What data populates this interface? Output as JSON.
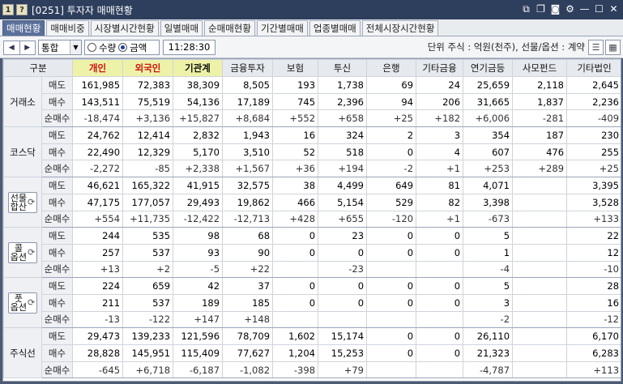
{
  "window": {
    "badge": "1",
    "title": "[0251] 투자자 매매현황",
    "icons": [
      "screen-link-icon",
      "copy-icon",
      "camera-icon",
      "settings-icon",
      "minimize-icon",
      "maximize-icon",
      "close-icon"
    ]
  },
  "tabs": [
    "매매현황",
    "매매비중",
    "시장별시간현황",
    "일별매매",
    "순매매현황",
    "기간별매매",
    "업종별매매",
    "전체시장시간현황"
  ],
  "toolbar": {
    "select_value": "통합",
    "radio_quantity": "수량",
    "radio_amount": "금액",
    "selected_radio": "금액",
    "time": "11:28:30",
    "unit_text": "단위 주식 : 억원(천주), 선물/옵션 : 계약"
  },
  "colors": {
    "positive": "#e0141d",
    "negative": "#1c3fc0",
    "highlight_header": "#eef2a8",
    "active_tab": "#5a6f99"
  },
  "table": {
    "corner": "구분",
    "columns": [
      "개인",
      "외국인",
      "기관계",
      "금융투자",
      "보험",
      "투신",
      "은행",
      "기타금융",
      "연기금등",
      "사모펀드",
      "기타법인"
    ],
    "row_labels": [
      "매도",
      "매수",
      "순매수"
    ],
    "groups": [
      {
        "name": "거래소",
        "button": false,
        "rows": [
          [
            "161,985",
            "72,383",
            "38,309",
            "8,505",
            "193",
            "1,738",
            "69",
            "24",
            "25,659",
            "2,118",
            "2,645"
          ],
          [
            "143,511",
            "75,519",
            "54,136",
            "17,189",
            "745",
            "2,396",
            "94",
            "206",
            "31,665",
            "1,837",
            "2,236"
          ],
          [
            "-18,474",
            "+3,136",
            "+15,827",
            "+8,684",
            "+552",
            "+658",
            "+25",
            "+182",
            "+6,006",
            "-281",
            "-409"
          ]
        ]
      },
      {
        "name": "코스닥",
        "button": false,
        "rows": [
          [
            "24,762",
            "12,414",
            "2,832",
            "1,943",
            "16",
            "324",
            "2",
            "3",
            "354",
            "187",
            "230"
          ],
          [
            "22,490",
            "12,329",
            "5,170",
            "3,510",
            "52",
            "518",
            "0",
            "4",
            "607",
            "476",
            "255"
          ],
          [
            "-2,272",
            "-85",
            "+2,338",
            "+1,567",
            "+36",
            "+194",
            "-2",
            "+1",
            "+253",
            "+289",
            "+25"
          ]
        ]
      },
      {
        "name": "선물합산",
        "name_lines": [
          "선물",
          "합산"
        ],
        "button": true,
        "rows": [
          [
            "46,621",
            "165,322",
            "41,915",
            "32,575",
            "38",
            "4,499",
            "649",
            "81",
            "4,071",
            "",
            "3,395"
          ],
          [
            "47,175",
            "177,057",
            "29,493",
            "19,862",
            "466",
            "5,154",
            "529",
            "82",
            "3,398",
            "",
            "3,528"
          ],
          [
            "+554",
            "+11,735",
            "-12,422",
            "-12,713",
            "+428",
            "+655",
            "-120",
            "+1",
            "-673",
            "",
            "+133"
          ]
        ]
      },
      {
        "name": "콜옵션",
        "name_lines": [
          "콜",
          "옵션"
        ],
        "button": true,
        "rows": [
          [
            "244",
            "535",
            "98",
            "68",
            "0",
            "23",
            "0",
            "0",
            "5",
            "",
            "22"
          ],
          [
            "257",
            "537",
            "93",
            "90",
            "0",
            "0",
            "0",
            "0",
            "1",
            "",
            "12"
          ],
          [
            "+13",
            "+2",
            "-5",
            "+22",
            "",
            "-23",
            "",
            "",
            "-4",
            "",
            "-10"
          ]
        ]
      },
      {
        "name": "풋옵션",
        "name_lines": [
          "풋",
          "옵션"
        ],
        "button": true,
        "rows": [
          [
            "224",
            "659",
            "42",
            "37",
            "0",
            "0",
            "0",
            "0",
            "5",
            "",
            "28"
          ],
          [
            "211",
            "537",
            "189",
            "185",
            "0",
            "0",
            "0",
            "0",
            "3",
            "",
            "16"
          ],
          [
            "-13",
            "-122",
            "+147",
            "+148",
            "",
            "",
            "",
            "",
            "-2",
            "",
            "-12"
          ]
        ]
      },
      {
        "name": "주식선",
        "button": false,
        "rows": [
          [
            "29,473",
            "139,233",
            "121,596",
            "78,709",
            "1,602",
            "15,174",
            "0",
            "0",
            "26,110",
            "",
            "6,170"
          ],
          [
            "28,828",
            "145,951",
            "115,409",
            "77,627",
            "1,204",
            "15,253",
            "0",
            "0",
            "21,323",
            "",
            "6,283"
          ],
          [
            "-645",
            "+6,718",
            "-6,187",
            "-1,082",
            "-398",
            "+79",
            "",
            "",
            "-4,787",
            "",
            "+113"
          ]
        ]
      }
    ]
  }
}
